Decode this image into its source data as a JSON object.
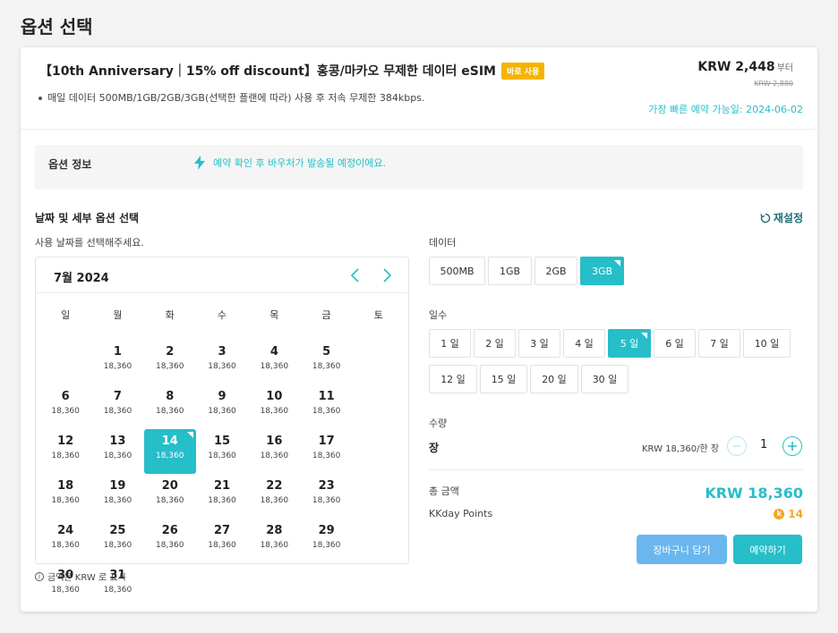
{
  "page": {
    "title": "옵션 선택"
  },
  "product": {
    "title": "【10th Anniversary｜15% off discount】홍콩/마카오 무제한 데이터 eSIM",
    "badge": "바로 사용",
    "description": "매일 데이터 500MB/1GB/2GB/3GB(선택한 플랜에 따라) 사용 후 저속 무제한 384kbps.",
    "price": "KRW 2,448",
    "price_suffix": "부터",
    "old_price": "KRW 2,880",
    "availability": "가장 빠른 예약 가능일: 2024-06-02"
  },
  "option_info": {
    "label": "옵션 정보",
    "text": "예약 확인 후 바우처가 발송될 예정이에요."
  },
  "section": {
    "title": "날짜 및 세부 옵션 선택",
    "reset": "재설정",
    "date_hint": "사용 날짜를 선택해주세요."
  },
  "calendar": {
    "month": "7월 2024",
    "weekdays": [
      "일",
      "월",
      "화",
      "수",
      "목",
      "금",
      "토"
    ],
    "days": [
      {
        "num": "",
        "price": ""
      },
      {
        "num": "1",
        "price": "18,360"
      },
      {
        "num": "2",
        "price": "18,360"
      },
      {
        "num": "3",
        "price": "18,360"
      },
      {
        "num": "4",
        "price": "18,360"
      },
      {
        "num": "5",
        "price": "18,360"
      },
      {
        "num": "6",
        "price": "18,360"
      },
      {
        "num": "7",
        "price": "18,360"
      },
      {
        "num": "8",
        "price": "18,360"
      },
      {
        "num": "9",
        "price": "18,360"
      },
      {
        "num": "10",
        "price": "18,360"
      },
      {
        "num": "11",
        "price": "18,360"
      },
      {
        "num": "12",
        "price": "18,360"
      },
      {
        "num": "13",
        "price": "18,360"
      },
      {
        "num": "14",
        "price": "18,360",
        "selected": true
      },
      {
        "num": "15",
        "price": "18,360"
      },
      {
        "num": "16",
        "price": "18,360"
      },
      {
        "num": "17",
        "price": "18,360"
      },
      {
        "num": "18",
        "price": "18,360"
      },
      {
        "num": "19",
        "price": "18,360"
      },
      {
        "num": "20",
        "price": "18,360"
      },
      {
        "num": "21",
        "price": "18,360"
      },
      {
        "num": "22",
        "price": "18,360"
      },
      {
        "num": "23",
        "price": "18,360"
      },
      {
        "num": "24",
        "price": "18,360"
      },
      {
        "num": "25",
        "price": "18,360"
      },
      {
        "num": "26",
        "price": "18,360"
      },
      {
        "num": "27",
        "price": "18,360"
      },
      {
        "num": "28",
        "price": "18,360"
      },
      {
        "num": "29",
        "price": "18,360"
      },
      {
        "num": "30",
        "price": "18,360"
      },
      {
        "num": "31",
        "price": "18,360"
      }
    ],
    "footnote": "금액은 KRW 로 표시"
  },
  "data_options": {
    "label": "데이터",
    "options": [
      "500MB",
      "1GB",
      "2GB",
      "3GB"
    ],
    "selected": "3GB"
  },
  "day_options": {
    "label": "일수",
    "options": [
      "1 일",
      "2 일",
      "3 일",
      "4 일",
      "5 일",
      "6 일",
      "7 일",
      "10 일",
      "12 일",
      "15 일",
      "20 일",
      "30 일"
    ],
    "selected": "5 일"
  },
  "quantity": {
    "label": "수량",
    "item": "장",
    "unit_price": "KRW 18,360/한 장",
    "value": "1"
  },
  "total": {
    "label": "총 금액",
    "value": "KRW 18,360"
  },
  "points": {
    "label": "KKday Points",
    "value": "14"
  },
  "buttons": {
    "cart": "장바구니 담기",
    "book": "예약하기"
  },
  "colors": {
    "accent": "#26bec9",
    "cart": "#69b7ee",
    "badge": "#f5b400",
    "points": "#f5a623"
  }
}
